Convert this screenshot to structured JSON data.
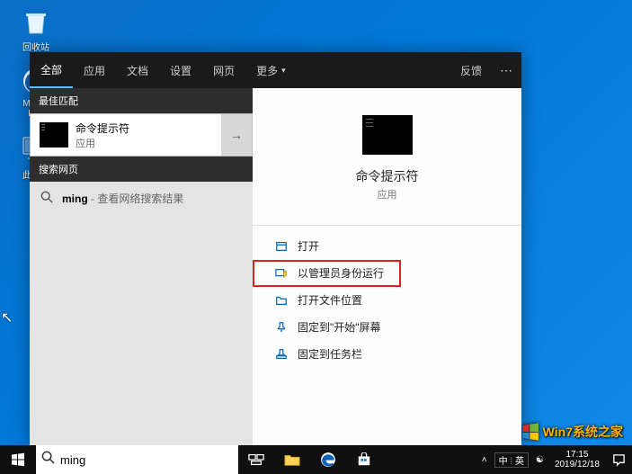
{
  "desktop": {
    "icons": [
      {
        "label": "回收站"
      },
      {
        "label": "Micros\nEdg"
      },
      {
        "label": "此电脑"
      }
    ]
  },
  "watermark": "Win7系统之家",
  "search": {
    "tabs": {
      "all": "全部",
      "apps": "应用",
      "docs": "文档",
      "settings": "设置",
      "web": "网页",
      "more": "更多"
    },
    "feedback": "反馈",
    "sections": {
      "best_match": "最佳匹配",
      "web": "搜索网页"
    },
    "best_match": {
      "title": "命令提示符",
      "subtitle": "应用"
    },
    "web_result": {
      "query": "ming",
      "suffix": " - 查看网络搜索结果"
    },
    "preview": {
      "title": "命令提示符",
      "subtitle": "应用"
    },
    "actions": {
      "open": "打开",
      "run_admin": "以管理员身份运行",
      "open_location": "打开文件位置",
      "pin_start": "固定到\"开始\"屏幕",
      "pin_taskbar": "固定到任务栏"
    },
    "input_value": "ming"
  },
  "tray": {
    "ime1": "中",
    "ime2": "英",
    "time": "17:15",
    "date": "2019/12/18"
  }
}
